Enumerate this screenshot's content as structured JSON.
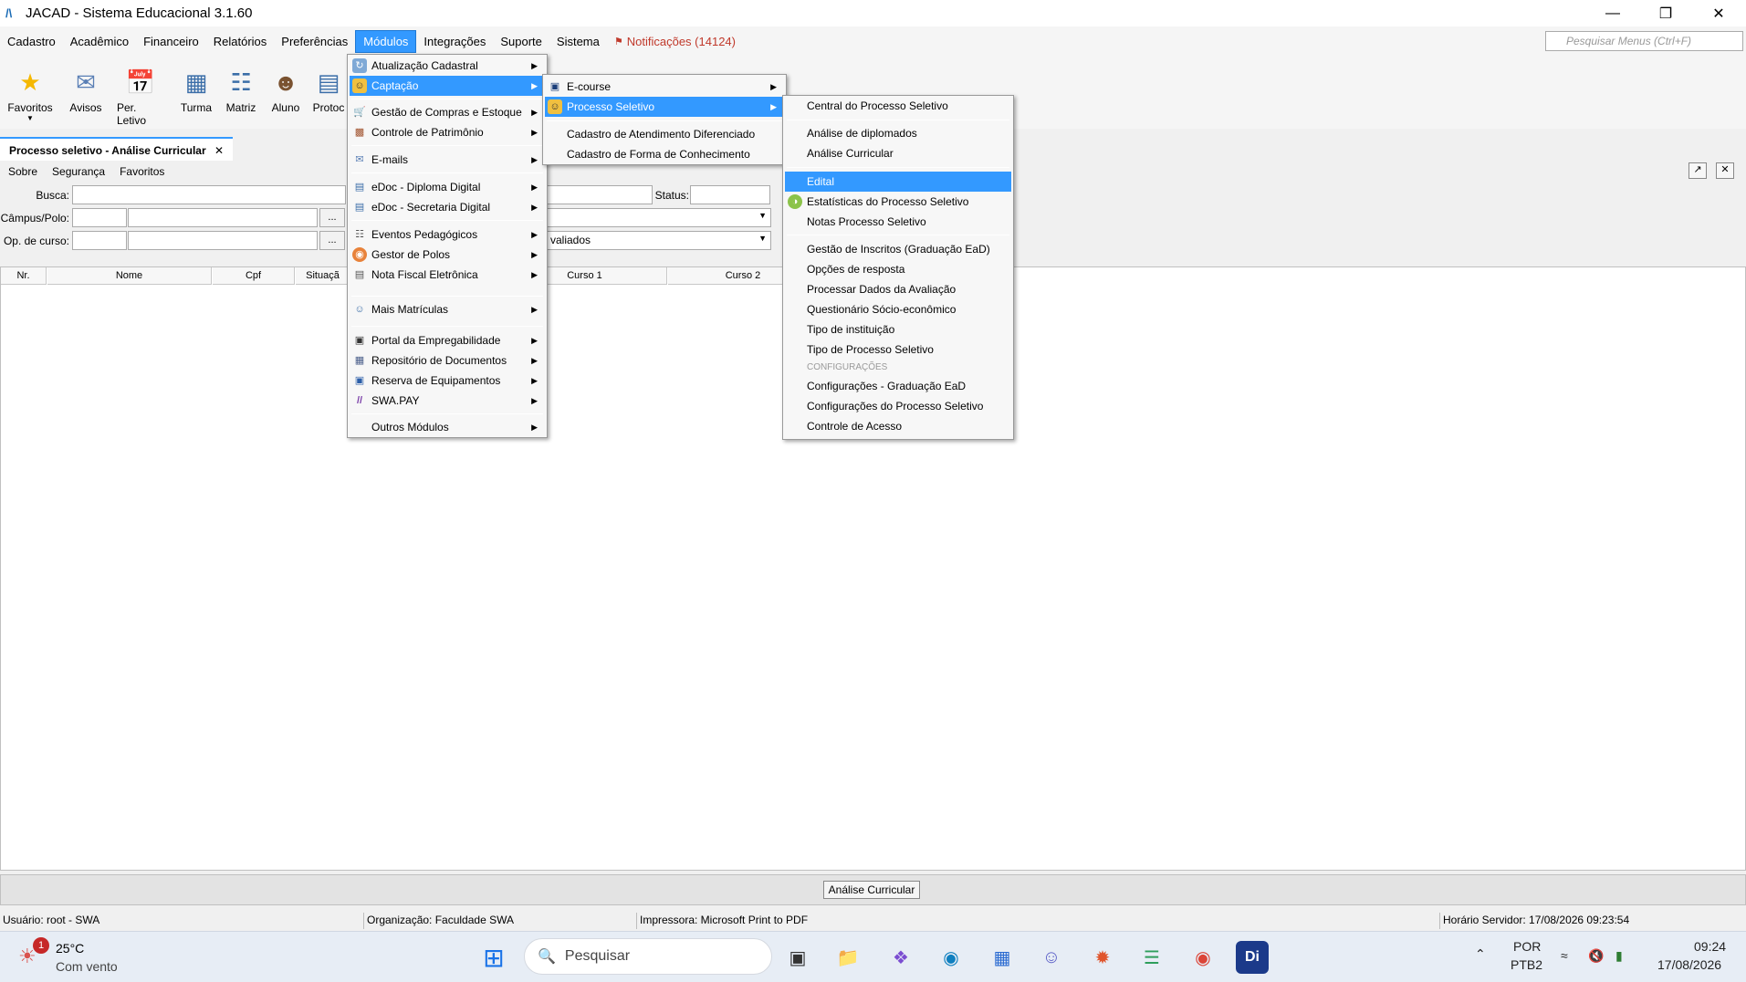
{
  "window": {
    "title": "JACAD - Sistema Educacional 3.1.60",
    "minimize": "—",
    "restore": "❐",
    "close": "✕"
  },
  "menubar": {
    "items": [
      "Cadastro",
      "Acadêmico",
      "Financeiro",
      "Relatórios",
      "Preferências",
      "Módulos",
      "Integrações",
      "Suporte",
      "Sistema"
    ],
    "notifications": "Notificações (14124)",
    "search_placeholder": "Pesquisar Menus (Ctrl+F)"
  },
  "toolbar": {
    "buttons": [
      "Favoritos",
      "Avisos",
      "Per. Letivo",
      "Turma",
      "Matriz",
      "Aluno",
      "Protoc"
    ]
  },
  "tab": {
    "title": "Processo seletivo - Análise Curricular",
    "close": "✕"
  },
  "subbar": {
    "items": [
      "Sobre",
      "Segurança",
      "Favoritos"
    ]
  },
  "form": {
    "busca_label": "Busca:",
    "campus_label": "Câmpus/Polo:",
    "opcurso_label": "Op. de curso:",
    "status_label": "Status:",
    "ellipsis": "...",
    "avaliados_value": "valiados"
  },
  "grid": {
    "columns": [
      "Nr.",
      "Nome",
      "Cpf",
      "Situaçã",
      "Curso 1",
      "Curso 2"
    ]
  },
  "bottom": {
    "button_label": "Análise Curricular"
  },
  "statusbar": {
    "usuario": "Usuário: root - SWA",
    "organizacao": "Organização: Faculdade SWA",
    "impressora": "Impressora: Microsoft Print to PDF",
    "horario": "Horário Servidor: 17/08/2026 09:23:54"
  },
  "menu_modulos": {
    "items": [
      "Atualização Cadastral",
      "Captação",
      "Gestão de Compras e Estoque",
      "Controle de Patrimônio",
      "E-mails",
      "eDoc - Diploma Digital",
      "eDoc - Secretaria Digital",
      "Eventos Pedagógicos",
      "Gestor de Polos",
      "Nota Fiscal Eletrônica",
      "Mais Matrículas",
      "Portal da Empregabilidade",
      "Repositório de Documentos",
      "Reserva de Equipamentos",
      "SWA.PAY",
      "Outros Módulos"
    ]
  },
  "menu_captacao": {
    "items": [
      "E-course",
      "Processo Seletivo",
      "Cadastro de Atendimento Diferenciado",
      "Cadastro de Forma de Conhecimento"
    ]
  },
  "menu_processo": {
    "items": [
      "Central do Processo Seletivo",
      "Análise de diplomados",
      "Análise Curricular",
      "Edital",
      "Estatísticas do Processo Seletivo",
      "Notas Processo Seletivo",
      "Gestão de Inscritos (Graduação EaD)",
      "Opções de resposta",
      "Processar Dados da Avaliação",
      "Questionário Sócio-econômico",
      "Tipo de instituição",
      "Tipo de Processo Seletivo"
    ],
    "section": "CONFIGURAÇÕES",
    "config_items": [
      "Configurações - Graduação EaD",
      "Configurações do Processo Seletivo",
      "Controle de Acesso"
    ]
  },
  "taskbar": {
    "weather_temp": "25°C",
    "weather_desc": "Com vento",
    "weather_badge": "1",
    "search": "Pesquisar",
    "lang1": "POR",
    "lang2": "PTB2",
    "time": "09:24",
    "date": "17/08/2026"
  }
}
